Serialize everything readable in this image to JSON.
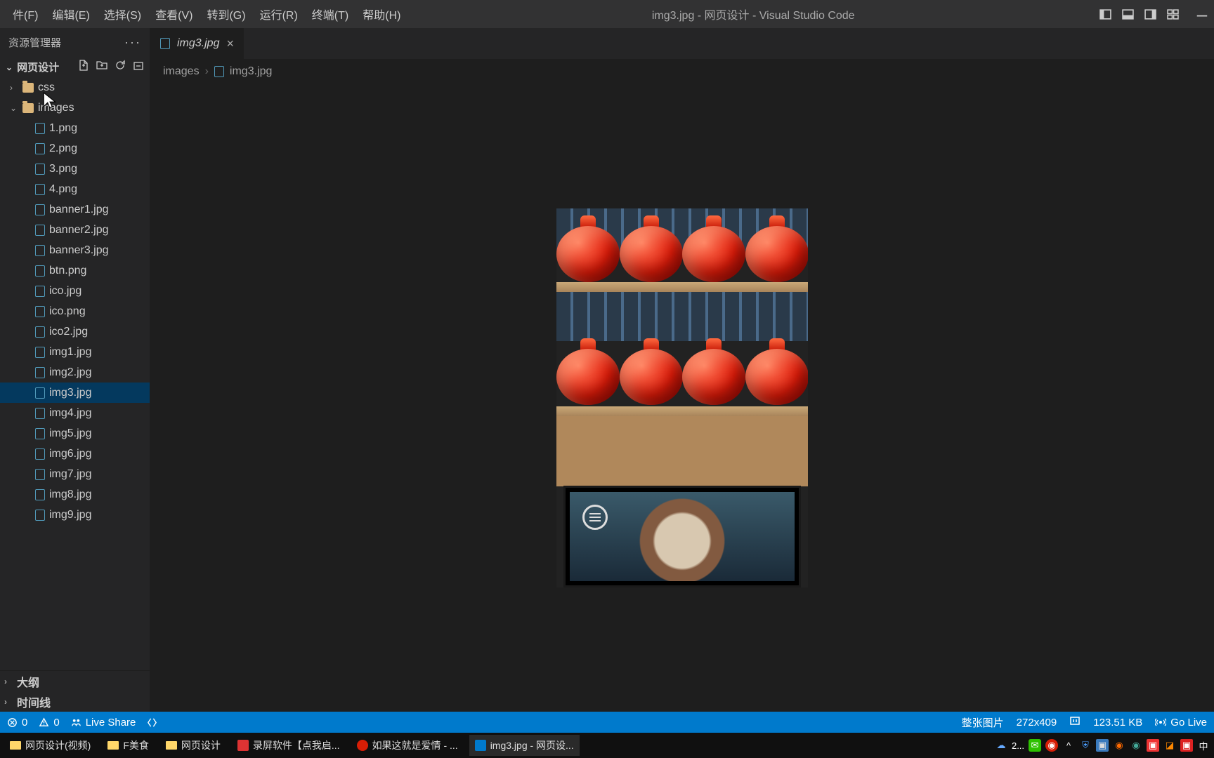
{
  "menubar": {
    "items": [
      "件(F)",
      "编辑(E)",
      "选择(S)",
      "查看(V)",
      "转到(G)",
      "运行(R)",
      "终端(T)",
      "帮助(H)"
    ],
    "title": "img3.jpg - 网页设计 - Visual Studio Code"
  },
  "sidebar": {
    "title": "资源管理器",
    "project": "网页设计",
    "action_icons": [
      "new-file-icon",
      "new-folder-icon",
      "refresh-icon",
      "collapse-icon"
    ],
    "folders": [
      {
        "name": "css",
        "expanded": false
      },
      {
        "name": "images",
        "expanded": true
      }
    ],
    "files": [
      "1.png",
      "2.png",
      "3.png",
      "4.png",
      "banner1.jpg",
      "banner2.jpg",
      "banner3.jpg",
      "btn.png",
      "ico.jpg",
      "ico.png",
      "ico2.jpg",
      "img1.jpg",
      "img2.jpg",
      "img3.jpg",
      "img4.jpg",
      "img5.jpg",
      "img6.jpg",
      "img7.jpg",
      "img8.jpg",
      "img9.jpg"
    ],
    "selected": "img3.jpg",
    "outline": "大纲",
    "timeline": "时间线"
  },
  "tab": {
    "label": "img3.jpg"
  },
  "breadcrumb": {
    "folder": "images",
    "file": "img3.jpg"
  },
  "image_size": "272x409",
  "statusbar": {
    "errors": "0",
    "warnings": "0",
    "liveshare": "Live Share",
    "img_label": "整张图片",
    "dimensions": "272x409",
    "filesize": "123.51 KB",
    "golive": "Go Live"
  },
  "taskbar": {
    "items": [
      {
        "label": "网页设计(视频)",
        "icon": "folder"
      },
      {
        "label": "F美食",
        "icon": "folder"
      },
      {
        "label": "网页设计",
        "icon": "folder"
      },
      {
        "label": "录屏软件【点我启...",
        "icon": "app-red"
      },
      {
        "label": "如果这就是爱情 - ...",
        "icon": "music"
      },
      {
        "label": "img3.jpg - 网页设...",
        "icon": "vscode",
        "active": true
      }
    ],
    "tray_time": "2...",
    "tray_lang": "中"
  }
}
